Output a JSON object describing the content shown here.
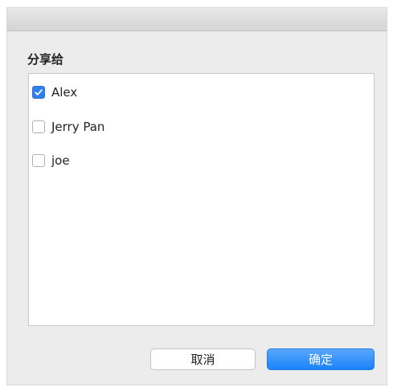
{
  "dialog": {
    "section_label": "分享给",
    "users": [
      {
        "name": "Alex",
        "checked": true
      },
      {
        "name": "Jerry Pan",
        "checked": false
      },
      {
        "name": "joe",
        "checked": false
      }
    ],
    "cancel_label": "取消",
    "confirm_label": "确定"
  },
  "colors": {
    "accent": "#1a82fb",
    "checkbox_checked": "#2f80ed",
    "background": "#ececec"
  },
  "icons": {
    "checkmark": "checkmark-icon"
  }
}
